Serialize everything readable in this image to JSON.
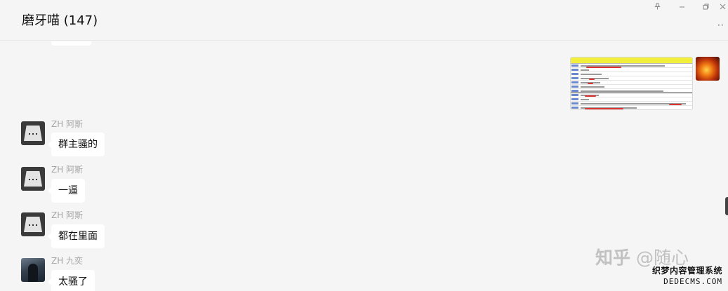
{
  "header": {
    "title": "磨牙喵 (147)",
    "pin_icon": "pin-icon",
    "minimize_icon": "minimize-icon",
    "restore_icon": "restore-icon",
    "close_icon": "close-icon",
    "more_icon": "more-dots-icon"
  },
  "messages": [
    {
      "sender": "ZH 阿斯",
      "text": "群主骚的",
      "avatar": "gray-placeholder-avatar"
    },
    {
      "sender": "ZH 阿斯",
      "text": "一逼",
      "avatar": "gray-placeholder-avatar"
    },
    {
      "sender": "ZH 阿斯",
      "text": "都在里面",
      "avatar": "gray-placeholder-avatar"
    },
    {
      "sender": "ZH 九奕",
      "text": "太骚了",
      "avatar": "photo-avatar"
    }
  ],
  "self_message": {
    "type": "image",
    "avatar": "fire-avatar"
  },
  "watermark": {
    "zhihu_logo": "知乎",
    "zhihu_handle": "@随心",
    "brand_line1": "织梦内容管理系统",
    "brand_line2": "DEDECMS.COM"
  }
}
